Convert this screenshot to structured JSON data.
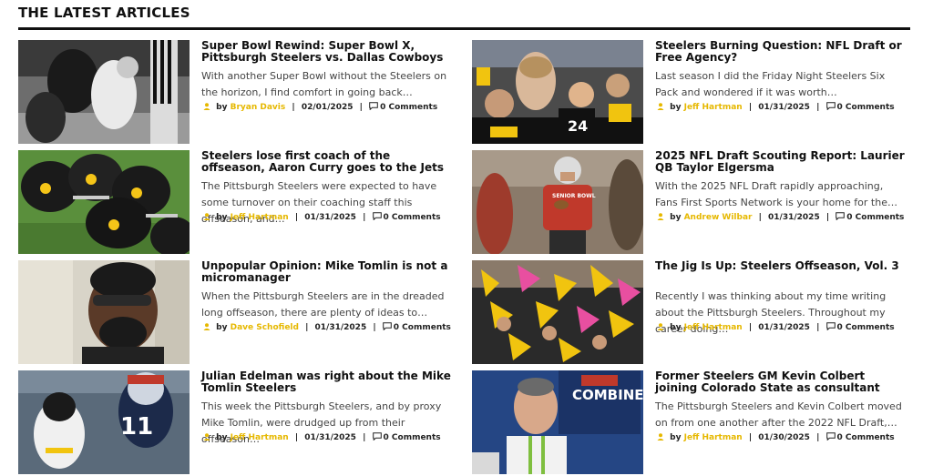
{
  "section": {
    "title": "THE LATEST ARTICLES"
  },
  "articles": [
    {
      "title": "Super Bowl Rewind: Super Bowl X, Pittsburgh Steelers vs. Dallas Cowboys",
      "excerpt": "With another Super Bowl without the Steelers on the horizon, I find comfort in going back…",
      "by": "by",
      "author": "Bryan Davis",
      "date": "02/01/2025",
      "comments": "0 Comments"
    },
    {
      "title": "Steelers Burning Question: NFL Draft or Free Agency?",
      "excerpt": "Last season I did the Friday Night Steelers Six Pack and wondered if it was worth…",
      "by": "by",
      "author": "Jeff Hartman",
      "date": "01/31/2025",
      "comments": "0 Comments"
    },
    {
      "title": "Steelers lose first coach of the offseason, Aaron Curry goes to the Jets",
      "excerpt": "The Pittsburgh Steelers were expected to have some turnover on their coaching staff this offseason, and…",
      "by": "by",
      "author": "Jeff Hartman",
      "date": "01/31/2025",
      "comments": "0 Comments"
    },
    {
      "title": "2025 NFL Draft Scouting Report: Laurier QB Taylor Elgersma",
      "excerpt": "With the 2025 NFL Draft rapidly approaching, Fans First Sports Network is your home for the…",
      "by": "by",
      "author": "Andrew Wilbar",
      "date": "01/31/2025",
      "comments": "0 Comments"
    },
    {
      "title": "Unpopular Opinion: Mike Tomlin is not a micromanager",
      "excerpt": "When the Pittsburgh Steelers are in the dreaded long offseason, there are plenty of ideas to…",
      "by": "by",
      "author": "Dave Schofield",
      "date": "01/31/2025",
      "comments": "0 Comments"
    },
    {
      "title": "The Jig Is Up: Steelers Offseason, Vol. 3",
      "excerpt": "Recently I was thinking about my time writing about the Pittsburgh Steelers. Throughout my career doing…",
      "by": "by",
      "author": "Jeff Hartman",
      "date": "01/31/2025",
      "comments": "0 Comments"
    },
    {
      "title": "Julian Edelman was right about the Mike Tomlin Steelers",
      "excerpt": "This week the Pittsburgh Steelers, and by proxy Mike Tomlin, were drudged up from their offseason…",
      "by": "by",
      "author": "Jeff Hartman",
      "date": "01/31/2025",
      "comments": "0 Comments"
    },
    {
      "title": "Former Steelers GM Kevin Colbert joining Colorado State as consultant",
      "excerpt": "The Pittsburgh Steelers and Kevin Colbert moved on from one another after the 2022 NFL Draft,…",
      "by": "by",
      "author": "Jeff Hartman",
      "date": "01/30/2025",
      "comments": "0 Comments"
    }
  ],
  "colors": {
    "accent": "#e6b800",
    "rule": "#111111"
  },
  "icons": {
    "author": "user-icon",
    "comments": "comment-icon"
  }
}
